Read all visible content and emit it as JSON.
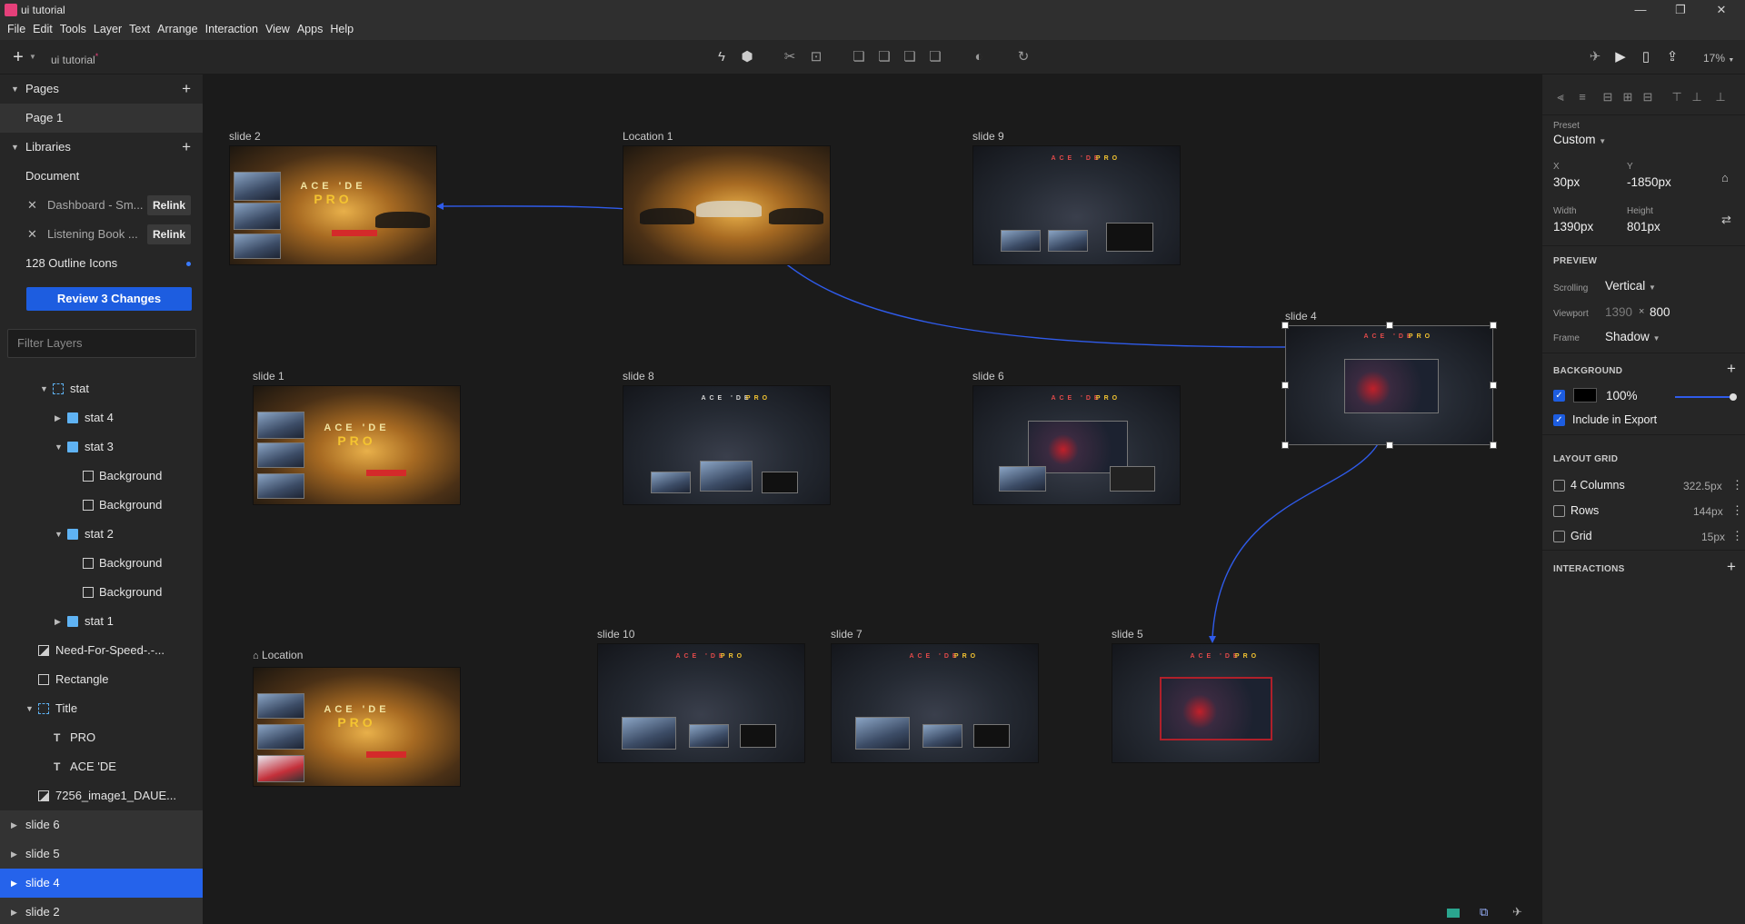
{
  "window": {
    "title": "ui tutorial"
  },
  "menu": [
    "File",
    "Edit",
    "Tools",
    "Layer",
    "Text",
    "Arrange",
    "Interaction",
    "View",
    "Apps",
    "Help"
  ],
  "toolbar": {
    "doc_title": "ui tutorial",
    "unsaved_mark": "*",
    "zoom": "17%"
  },
  "left": {
    "pages_label": "Pages",
    "page1": "Page 1",
    "libraries_label": "Libraries",
    "document_label": "Document",
    "libs": [
      {
        "name": "Dashboard - Sm...",
        "action": "Relink"
      },
      {
        "name": "Listening Book ...",
        "action": "Relink"
      }
    ],
    "icons_lib": "128 Outline Icons",
    "review_btn": "Review 3 Changes",
    "filter_placeholder": "Filter Layers",
    "layers": [
      {
        "label": "stat",
        "icon": "group-icon"
      },
      {
        "label": "stat 4",
        "icon": "folder-icon"
      },
      {
        "label": "stat 3",
        "icon": "folder-icon"
      },
      {
        "label": "Background",
        "icon": "rect-icon"
      },
      {
        "label": "Background",
        "icon": "rect-icon"
      },
      {
        "label": "stat 2",
        "icon": "folder-icon"
      },
      {
        "label": "Background",
        "icon": "rect-icon"
      },
      {
        "label": "Background",
        "icon": "rect-icon"
      },
      {
        "label": "stat 1",
        "icon": "folder-icon"
      },
      {
        "label": "Need-For-Speed-.-...",
        "icon": "image-icon"
      },
      {
        "label": "Rectangle",
        "icon": "rect-icon"
      },
      {
        "label": "Title",
        "icon": "group-icon"
      },
      {
        "label": "PRO",
        "icon": "text-icon"
      },
      {
        "label": "ACE 'DE",
        "icon": "text-icon"
      },
      {
        "label": "7256_image1_DAUE...",
        "icon": "image-icon"
      },
      {
        "label": "slide 6",
        "icon": "artboard"
      },
      {
        "label": "slide 5",
        "icon": "artboard"
      },
      {
        "label": "slide 4",
        "icon": "artboard"
      },
      {
        "label": "slide 2",
        "icon": "artboard"
      }
    ]
  },
  "artboards": [
    {
      "label": "slide 2",
      "title1": "ACE 'DE",
      "title2": "PRO"
    },
    {
      "label": "Location 1",
      "title1": "",
      "title2": ""
    },
    {
      "label": "slide 9",
      "title1": "ACE 'DE",
      "title2": "PRO"
    },
    {
      "label": "slide 4",
      "title1": "ACE 'DE",
      "title2": "PRO"
    },
    {
      "label": "slide 1",
      "title1": "ACE 'DE",
      "title2": "PRO"
    },
    {
      "label": "slide 8",
      "title1": "ACE 'DE",
      "title2": "PRO"
    },
    {
      "label": "slide 6",
      "title1": "ACE 'DE",
      "title2": "PRO"
    },
    {
      "label": "Location",
      "title1": "ACE 'DE",
      "title2": "PRO"
    },
    {
      "label": "slide 10",
      "title1": "ACE 'DE",
      "title2": "PRO"
    },
    {
      "label": "slide 7",
      "title1": "ACE 'DE",
      "title2": "PRO"
    },
    {
      "label": "slide 5",
      "title1": "ACE 'DE",
      "title2": "PRO"
    }
  ],
  "right": {
    "preset_label": "Preset",
    "preset_value": "Custom",
    "x_label": "X",
    "x_value": "30px",
    "y_label": "Y",
    "y_value": "-1850px",
    "w_label": "Width",
    "w_value": "1390px",
    "h_label": "Height",
    "h_value": "801px",
    "preview_label": "PREVIEW",
    "scrolling_label": "Scrolling",
    "scrolling_value": "Vertical",
    "viewport_label": "Viewport",
    "viewport_w": "1390",
    "viewport_x": "×",
    "viewport_h": "800",
    "frame_label": "Frame",
    "frame_value": "Shadow",
    "background_label": "BACKGROUND",
    "bg_opacity": "100%",
    "include_export": "Include in Export",
    "layout_grid_label": "LAYOUT GRID",
    "grids": [
      {
        "name": "4 Columns",
        "value": "322.5px"
      },
      {
        "name": "Rows",
        "value": "144px"
      },
      {
        "name": "Grid",
        "value": "15px"
      }
    ],
    "interactions_label": "INTERACTIONS"
  },
  "colors": {
    "accent": "#1d5de0",
    "selection": "#2563eb",
    "flow": "#2f5bea"
  }
}
